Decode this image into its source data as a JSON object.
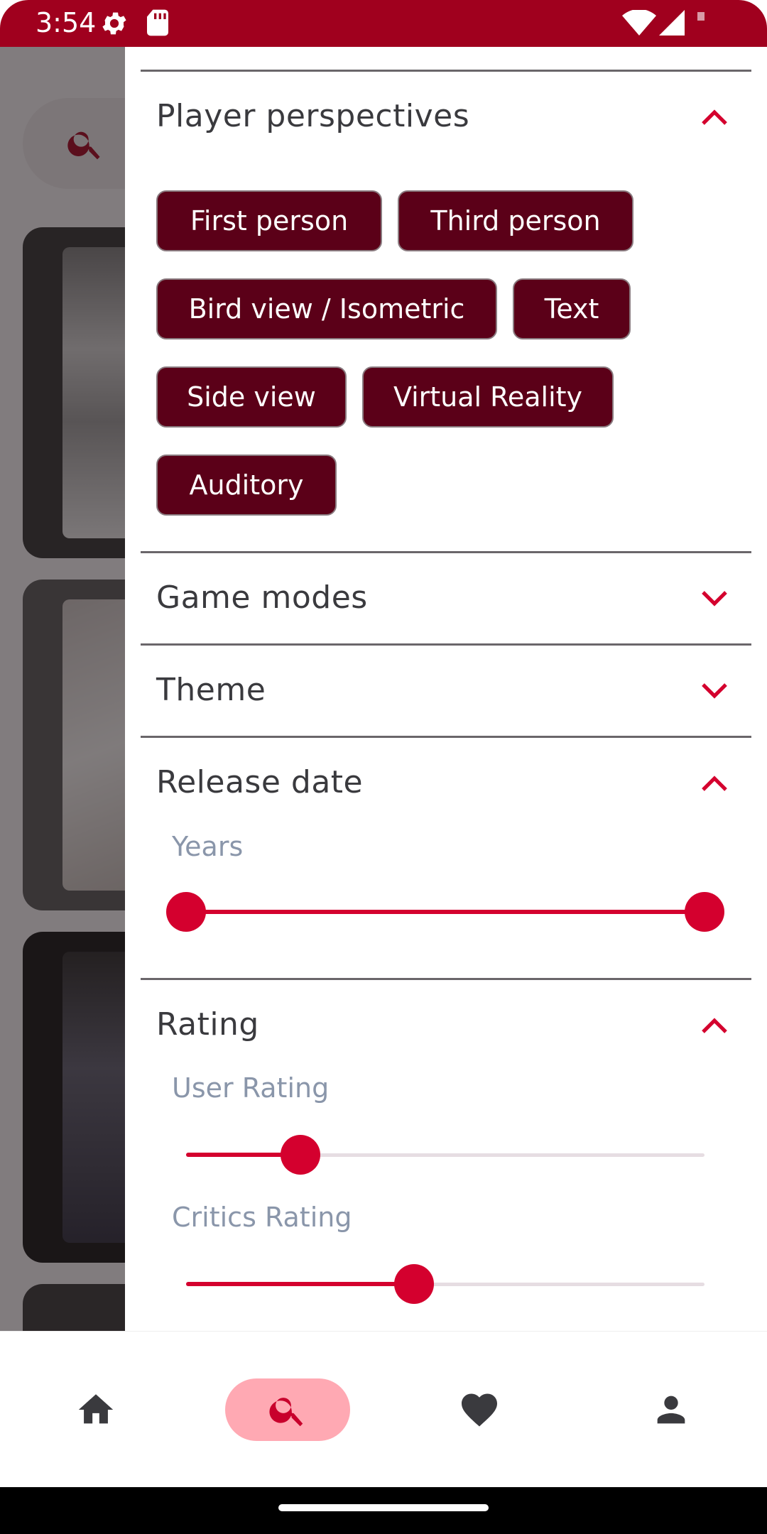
{
  "status_bar": {
    "time": "3:54",
    "background": "#a0001e",
    "icons": [
      "settings-gear-icon",
      "sd-card-icon",
      "wifi-icon",
      "signal-icon",
      "battery-icon"
    ]
  },
  "filters": {
    "player_perspectives": {
      "title": "Player perspectives",
      "expanded": true,
      "chips": [
        "First person",
        "Third person",
        "Bird view / Isometric",
        "Text",
        "Side view",
        "Virtual Reality",
        "Auditory"
      ]
    },
    "game_modes": {
      "title": "Game modes",
      "expanded": false
    },
    "theme": {
      "title": "Theme",
      "expanded": false
    },
    "release_date": {
      "title": "Release date",
      "expanded": true,
      "years_label": "Years",
      "range_start": 0.0,
      "range_end": 1.0
    },
    "rating": {
      "title": "Rating",
      "expanded": true,
      "user_rating_label": "User Rating",
      "user_rating_value": 0.22,
      "critics_rating_label": "Critics Rating",
      "critics_rating_value": 0.44
    }
  },
  "bottom_nav": {
    "items": [
      {
        "name": "home",
        "icon": "home-icon",
        "active": false
      },
      {
        "name": "search",
        "icon": "search-icon",
        "active": true
      },
      {
        "name": "favorites",
        "icon": "heart-icon",
        "active": false
      },
      {
        "name": "profile",
        "icon": "person-icon",
        "active": false
      }
    ]
  },
  "colors": {
    "accent": "#d4002e",
    "chip_background": "#5b0018",
    "active_nav_pill": "#ffa9b3",
    "label_grey": "#8a96aa"
  }
}
